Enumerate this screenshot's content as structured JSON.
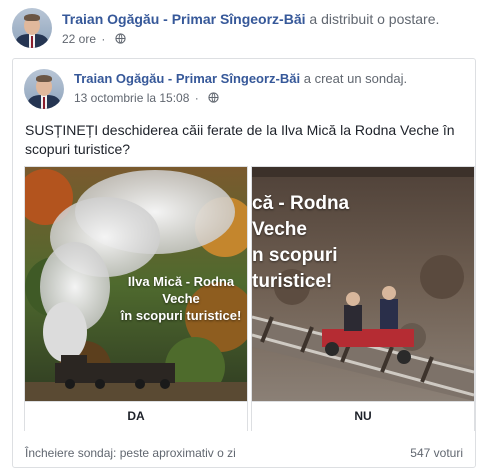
{
  "share": {
    "author": "Traian Ogăgău - Primar Sîngeorz-Băi",
    "action": "a distribuit o postare.",
    "time": "22 ore",
    "separator": "·",
    "privacy_icon": "globe-icon"
  },
  "post": {
    "author": "Traian Ogăgău - Primar Sîngeorz-Băi",
    "action": "a creat un sondaj.",
    "time": "13 octombrie la 15:08",
    "separator": "·",
    "privacy_icon": "globe-icon",
    "question": "SUSȚINEȚI deschiderea căii ferate de la Ilva Mică la Rodna Veche în scopuri turistice?"
  },
  "poll": {
    "options": [
      {
        "label": "DA",
        "image_caption_line1": "Ilva Mică - Rodna Veche",
        "image_caption_line2": "în scopuri turistice!"
      },
      {
        "label": "NU",
        "image_caption_line1": "că - Rodna Veche",
        "image_caption_line2": "n scopuri turistice!"
      }
    ],
    "closing_text": "Încheiere sondaj: peste aproximativ o zi",
    "votes": "547 voturi"
  },
  "colors": {
    "link": "#365899",
    "meta": "#616770",
    "border": "#dddfe2"
  }
}
